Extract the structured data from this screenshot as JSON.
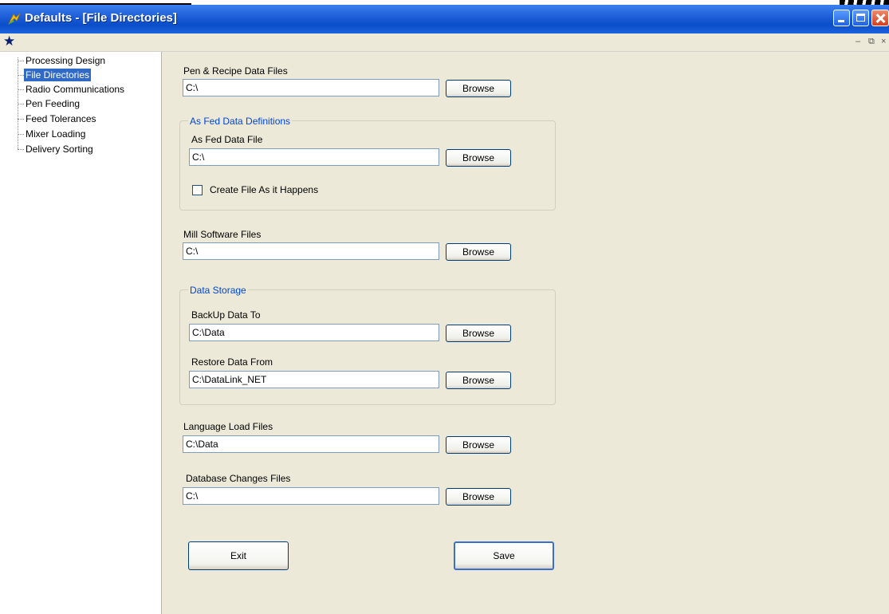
{
  "window": {
    "title": "Defaults - [File Directories]"
  },
  "tree": {
    "items": [
      {
        "label": "Processing Design",
        "selected": false
      },
      {
        "label": "File Directories",
        "selected": true
      },
      {
        "label": "Radio Communications",
        "selected": false
      },
      {
        "label": "Pen Feeding",
        "selected": false
      },
      {
        "label": "Feed Tolerances",
        "selected": false
      },
      {
        "label": "Mixer Loading",
        "selected": false
      },
      {
        "label": "Delivery Sorting",
        "selected": false
      }
    ]
  },
  "form": {
    "pen_recipe": {
      "label": "Pen & Recipe Data Files",
      "value": "C:\\",
      "browse": "Browse"
    },
    "as_fed_group": {
      "title": "As Fed Data Definitions",
      "file_label": "As Fed Data File",
      "file_value": "C:\\",
      "browse": "Browse",
      "checkbox_label": "Create File As it Happens",
      "checkbox_checked": false
    },
    "mill_software": {
      "label": "Mill Software Files",
      "value": "C:\\",
      "browse": "Browse"
    },
    "data_storage": {
      "title": "Data Storage",
      "backup_label": "BackUp Data To",
      "backup_value": "C:\\Data",
      "restore_label": "Restore Data From",
      "restore_value": "C:\\DataLink_NET",
      "browse": "Browse"
    },
    "language": {
      "label": "Language Load Files",
      "value": "C:\\Data",
      "browse": "Browse"
    },
    "database_changes": {
      "label": "Database Changes Files",
      "value": "C:\\",
      "browse": "Browse"
    },
    "exit_label": "Exit",
    "save_label": "Save"
  }
}
